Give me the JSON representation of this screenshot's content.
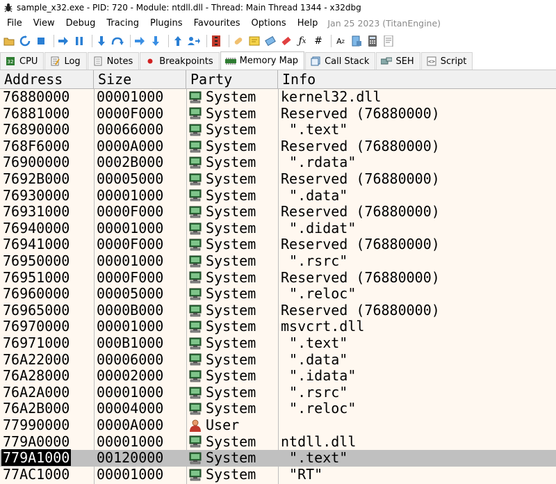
{
  "window": {
    "title": "sample_x32.exe - PID: 720 - Module: ntdll.dll - Thread: Main Thread 1344 - x32dbg"
  },
  "menu": {
    "items": [
      "File",
      "View",
      "Debug",
      "Tracing",
      "Plugins",
      "Favourites",
      "Options",
      "Help"
    ],
    "build_note": "Jan 25 2023 (TitanEngine)"
  },
  "toolbar": {
    "icons": [
      "open-icon",
      "restart-icon",
      "stop-icon",
      "run-icon",
      "pause-icon",
      "step-into-icon",
      "step-over-icon",
      "trace-into-icon",
      "trace-over-icon",
      "execute-till-return-icon",
      "run-to-user-code-icon",
      "scylla-icon",
      "patch-icon",
      "comment-icon",
      "label-icon",
      "bookmark-icon",
      "function-icon",
      "hash-icon",
      "strings-icon",
      "calculator-icon",
      "cheatsheet-icon"
    ]
  },
  "tabs": [
    {
      "label": "CPU",
      "icon": "cpu-icon"
    },
    {
      "label": "Log",
      "icon": "log-icon"
    },
    {
      "label": "Notes",
      "icon": "notes-icon"
    },
    {
      "label": "Breakpoints",
      "icon": "breakpoint-dot-icon"
    },
    {
      "label": "Memory Map",
      "icon": "memory-map-icon",
      "active": true
    },
    {
      "label": "Call Stack",
      "icon": "call-stack-icon"
    },
    {
      "label": "SEH",
      "icon": "seh-icon"
    },
    {
      "label": "Script",
      "icon": "script-icon"
    }
  ],
  "columns": {
    "address": "Address",
    "size": "Size",
    "party": "Party",
    "info": "Info"
  },
  "rows": [
    {
      "address": "76880000",
      "size": "00001000",
      "party": "System",
      "info": "kernel32.dll"
    },
    {
      "address": "76881000",
      "size": "0000F000",
      "party": "System",
      "info": "Reserved (76880000)"
    },
    {
      "address": "76890000",
      "size": "00066000",
      "party": "System",
      "info": " \".text\""
    },
    {
      "address": "768F6000",
      "size": "0000A000",
      "party": "System",
      "info": "Reserved (76880000)"
    },
    {
      "address": "76900000",
      "size": "0002B000",
      "party": "System",
      "info": " \".rdata\""
    },
    {
      "address": "7692B000",
      "size": "00005000",
      "party": "System",
      "info": "Reserved (76880000)"
    },
    {
      "address": "76930000",
      "size": "00001000",
      "party": "System",
      "info": " \".data\""
    },
    {
      "address": "76931000",
      "size": "0000F000",
      "party": "System",
      "info": "Reserved (76880000)"
    },
    {
      "address": "76940000",
      "size": "00001000",
      "party": "System",
      "info": " \".didat\""
    },
    {
      "address": "76941000",
      "size": "0000F000",
      "party": "System",
      "info": "Reserved (76880000)"
    },
    {
      "address": "76950000",
      "size": "00001000",
      "party": "System",
      "info": " \".rsrc\""
    },
    {
      "address": "76951000",
      "size": "0000F000",
      "party": "System",
      "info": "Reserved (76880000)"
    },
    {
      "address": "76960000",
      "size": "00005000",
      "party": "System",
      "info": " \".reloc\""
    },
    {
      "address": "76965000",
      "size": "0000B000",
      "party": "System",
      "info": "Reserved (76880000)"
    },
    {
      "address": "76970000",
      "size": "00001000",
      "party": "System",
      "info": "msvcrt.dll"
    },
    {
      "address": "76971000",
      "size": "000B1000",
      "party": "System",
      "info": " \".text\""
    },
    {
      "address": "76A22000",
      "size": "00006000",
      "party": "System",
      "info": " \".data\""
    },
    {
      "address": "76A28000",
      "size": "00002000",
      "party": "System",
      "info": " \".idata\""
    },
    {
      "address": "76A2A000",
      "size": "00001000",
      "party": "System",
      "info": " \".rsrc\""
    },
    {
      "address": "76A2B000",
      "size": "00004000",
      "party": "System",
      "info": " \".reloc\""
    },
    {
      "address": "77990000",
      "size": "0000A000",
      "party": "User",
      "info": ""
    },
    {
      "address": "779A0000",
      "size": "00001000",
      "party": "System",
      "info": "ntdll.dll"
    },
    {
      "address": "779A1000",
      "size": "00120000",
      "party": "System",
      "info": " \".text\"",
      "selected": true
    },
    {
      "address": "77AC1000",
      "size": "00001000",
      "party": "System",
      "info": " \"RT\""
    }
  ],
  "colors": {
    "grid_bg": "#fff8f0",
    "header_bg": "#f0f0f0",
    "selected_row": "#c0c0c0",
    "selected_addr_bg": "#000000",
    "selected_addr_fg": "#ffffff"
  }
}
